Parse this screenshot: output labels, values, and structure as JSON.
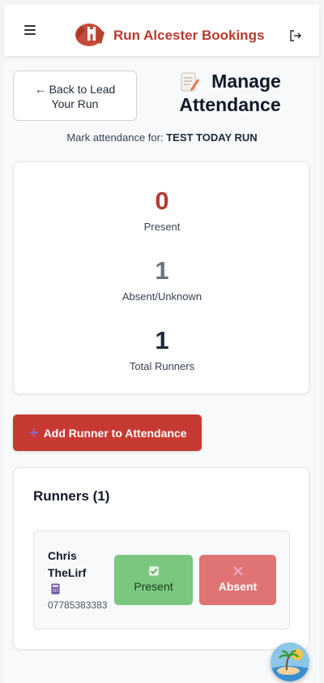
{
  "header": {
    "brand": "Run Alcester Bookings",
    "menu_icon": "hamburger-icon",
    "logo_icon": "castle-logo-icon",
    "logout_icon": "logout-icon"
  },
  "nav": {
    "back_label_line1": "← Back to Lead",
    "back_label_line2": "Your Run"
  },
  "page": {
    "title_line1": "Manage",
    "title_line2": "Attendance",
    "title_icon": "memo-icon",
    "subtitle_prefix": "Mark attendance for:",
    "run_name": "TEST TODAY RUN"
  },
  "stats": {
    "present": {
      "value": "0",
      "label": "Present",
      "color": "#b83a2f"
    },
    "absent": {
      "value": "1",
      "label": "Absent/Unknown",
      "color": "#6b7280"
    },
    "total": {
      "value": "1",
      "label": "Total Runners",
      "color": "#1f2937"
    }
  },
  "actions": {
    "add_runner_label": "Add Runner to Attendance",
    "accent": "#c73a33"
  },
  "runners": {
    "title": "Runners (1)",
    "items": [
      {
        "first_name": "Chris",
        "last_name": "TheLirf",
        "phone": "07785383383",
        "present_label": "Present",
        "absent_label": "Absent"
      }
    ]
  },
  "fab_icon": "island-icon"
}
